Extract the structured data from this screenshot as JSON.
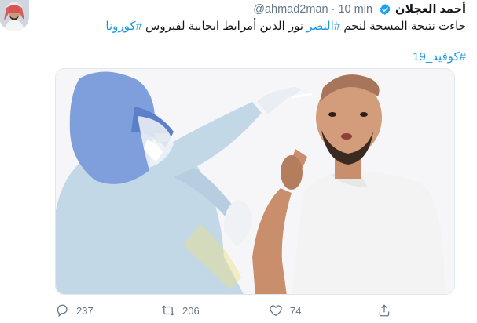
{
  "tweet": {
    "author_name": "أحمد العجلان",
    "handle": "@ahmad2man",
    "separator": "·",
    "time": "10 min",
    "text": {
      "part1": "جاءت نتيجة المسحة لنجم ",
      "hashtag_club": "#النصر",
      "part2": " نور الدين أمرابط ايجابية لفيروس ",
      "hashtag_corona": "#كورونا"
    },
    "hashtag_covid": "#كوفيد_19"
  },
  "actions": {
    "reply_count": "237",
    "retweet_count": "206",
    "like_count": "74"
  },
  "icons": {
    "verified": "verified-badge-icon",
    "reply": "reply-icon",
    "retweet": "retweet-icon",
    "like": "heart-icon",
    "share": "share-icon"
  },
  "colors": {
    "link": "#1b95e0",
    "verified": "#1da1f2",
    "muted": "#657786"
  }
}
